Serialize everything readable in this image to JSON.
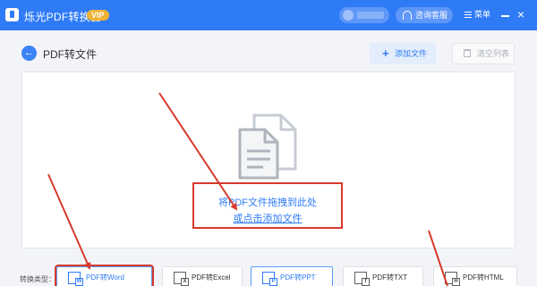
{
  "titlebar": {
    "app_name": "烁光PDF转换器",
    "vip_badge": "VIP",
    "service_button": "咨询客服",
    "menu_button": "菜单",
    "close_glyph": "×"
  },
  "toolbar": {
    "back_glyph": "←",
    "page_title": "PDF转文件",
    "add_file_label": "添加文件",
    "add_file_glyph": "+",
    "clear_list_label": "清空列表"
  },
  "dropzone": {
    "line1": "将PDF文件拖拽到此处",
    "line2": "或点击添加文件"
  },
  "conversion": {
    "label": "转换类型：",
    "types": [
      {
        "label": "PDF转Word",
        "tag": "W",
        "selected": true
      },
      {
        "label": "PDF转Excel",
        "tag": "X",
        "selected": false
      },
      {
        "label": "PDF转PPT",
        "tag": "P",
        "selected": false
      },
      {
        "label": "PDF转TXT",
        "tag": "T",
        "selected": false
      },
      {
        "label": "PDF转HTML",
        "tag": "H",
        "selected": false
      }
    ]
  },
  "colors": {
    "primary": "#2f7bf6",
    "annotation_red": "#d63a2c",
    "vip_gold": "#f0b233"
  }
}
